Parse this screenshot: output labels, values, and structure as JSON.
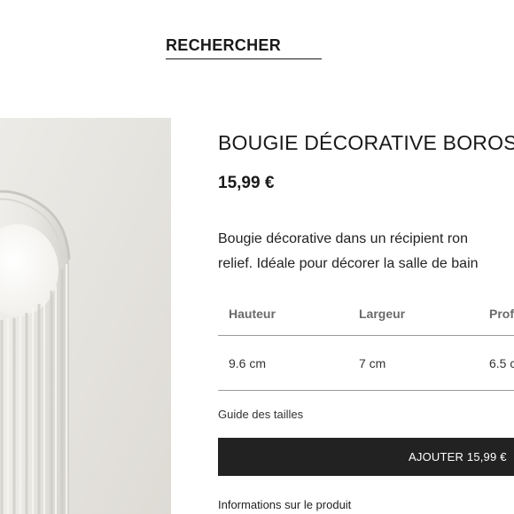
{
  "header": {
    "search_label": "RECHERCHER"
  },
  "product": {
    "title": "BOUGIE DÉCORATIVE BOROS",
    "price": "15,99 €",
    "description_lines": [
      "Bougie décorative dans un récipient ron",
      "relief. Idéale pour décorer la salle de bain"
    ],
    "image": {
      "icon": "glass-candle-image",
      "colors": {
        "background": "#e6e3dd",
        "glass": "#f3f2ee",
        "wax": "#ffffff"
      }
    }
  },
  "dimensions": {
    "headers": [
      "Hauteur",
      "Largeur",
      "Prof"
    ],
    "values": [
      "9.6 cm",
      "7 cm",
      "6.5 c"
    ]
  },
  "links": {
    "size_guide": "Guide des tailles",
    "product_info": "Informations sur le produit"
  },
  "actions": {
    "add_to_cart": "AJOUTER 15,99 €"
  },
  "colors": {
    "button_bg": "#222222",
    "text": "#1a1a1a",
    "divider": "#9a9a9a"
  }
}
